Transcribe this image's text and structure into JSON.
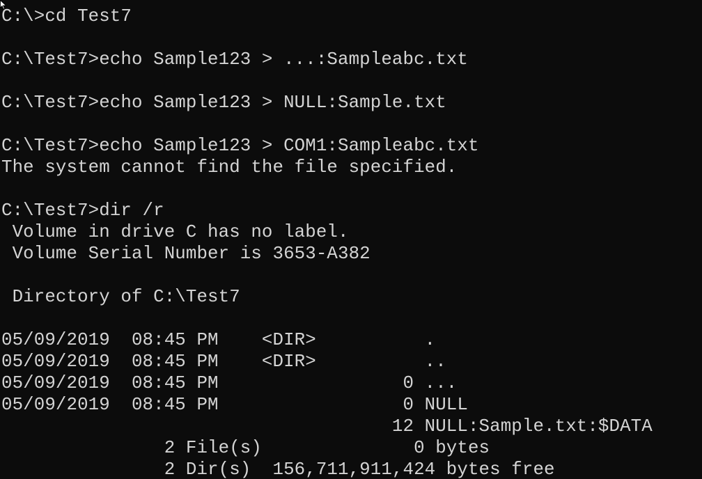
{
  "console": {
    "lines": [
      "C:\\>cd Test7",
      "",
      "C:\\Test7>echo Sample123 > ...:Sampleabc.txt",
      "",
      "C:\\Test7>echo Sample123 > NULL:Sample.txt",
      "",
      "C:\\Test7>echo Sample123 > COM1:Sampleabc.txt",
      "The system cannot find the file specified.",
      "",
      "C:\\Test7>dir /r",
      " Volume in drive C has no label.",
      " Volume Serial Number is 3653-A382",
      "",
      " Directory of C:\\Test7",
      "",
      "05/09/2019  08:45 PM    <DIR>          .",
      "05/09/2019  08:45 PM    <DIR>          ..",
      "05/09/2019  08:45 PM                 0 ...",
      "05/09/2019  08:45 PM                 0 NULL",
      "                                    12 NULL:Sample.txt:$DATA",
      "               2 File(s)              0 bytes",
      "               2 Dir(s)  156,711,911,424 bytes free"
    ],
    "text_color": "#d4d4d4",
    "background_color": "#0c0c0c"
  },
  "mouse_pointer": {
    "icon": "mouse-pointer-icon"
  }
}
